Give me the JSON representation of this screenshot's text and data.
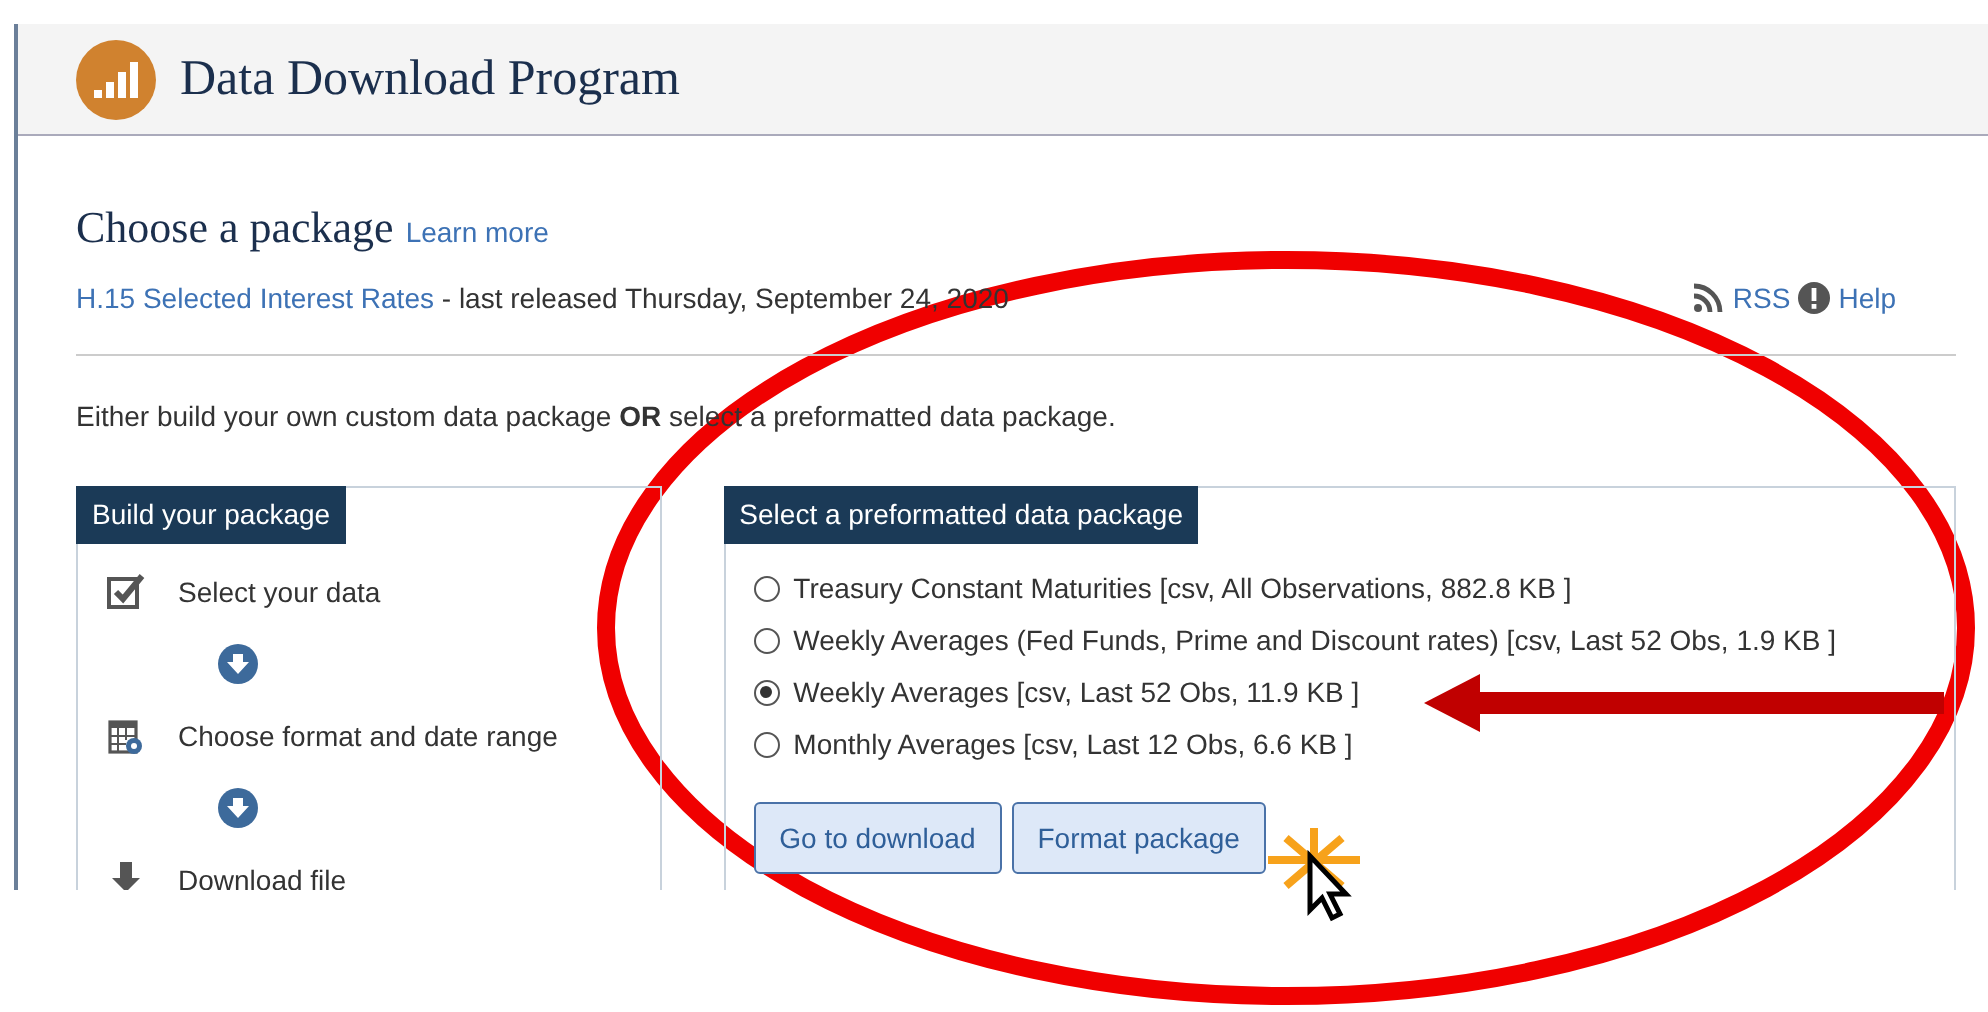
{
  "header": {
    "title": "Data Download Program"
  },
  "section": {
    "title": "Choose a package",
    "learn_more": "Learn more"
  },
  "release": {
    "link": "H.15 Selected Interest Rates",
    "text": " - last released Thursday, September 24, 2020"
  },
  "links": [
    {
      "kind": "rss",
      "label": "RSS"
    },
    {
      "kind": "help",
      "label": "Help"
    }
  ],
  "intro": "Either build your own custom data package **OR** select a preformatted data package.",
  "build_panel": {
    "title": "Build your package",
    "steps": [
      {
        "kind": "select",
        "label": "Select your data"
      },
      {
        "kind": "format",
        "label": "Choose format and date range"
      },
      {
        "kind": "download",
        "label": "Download file"
      }
    ]
  },
  "preformatted_panel": {
    "title": "Select a preformatted data package",
    "options": [
      {
        "label": "Treasury Constant Maturities [csv, All Observations, 882.8 KB ]",
        "selected": false
      },
      {
        "label": "Weekly Averages (Fed Funds, Prime and Discount rates) [csv, Last 52 Obs, 1.9 KB ]",
        "selected": false
      },
      {
        "label": "Weekly Averages [csv, Last 52 Obs, 11.9 KB ]",
        "selected": true
      },
      {
        "label": "Monthly Averages [csv, Last 12 Obs, 6.6 KB ]",
        "selected": false
      }
    ],
    "buttons": [
      "Go to download",
      "Format package"
    ]
  }
}
